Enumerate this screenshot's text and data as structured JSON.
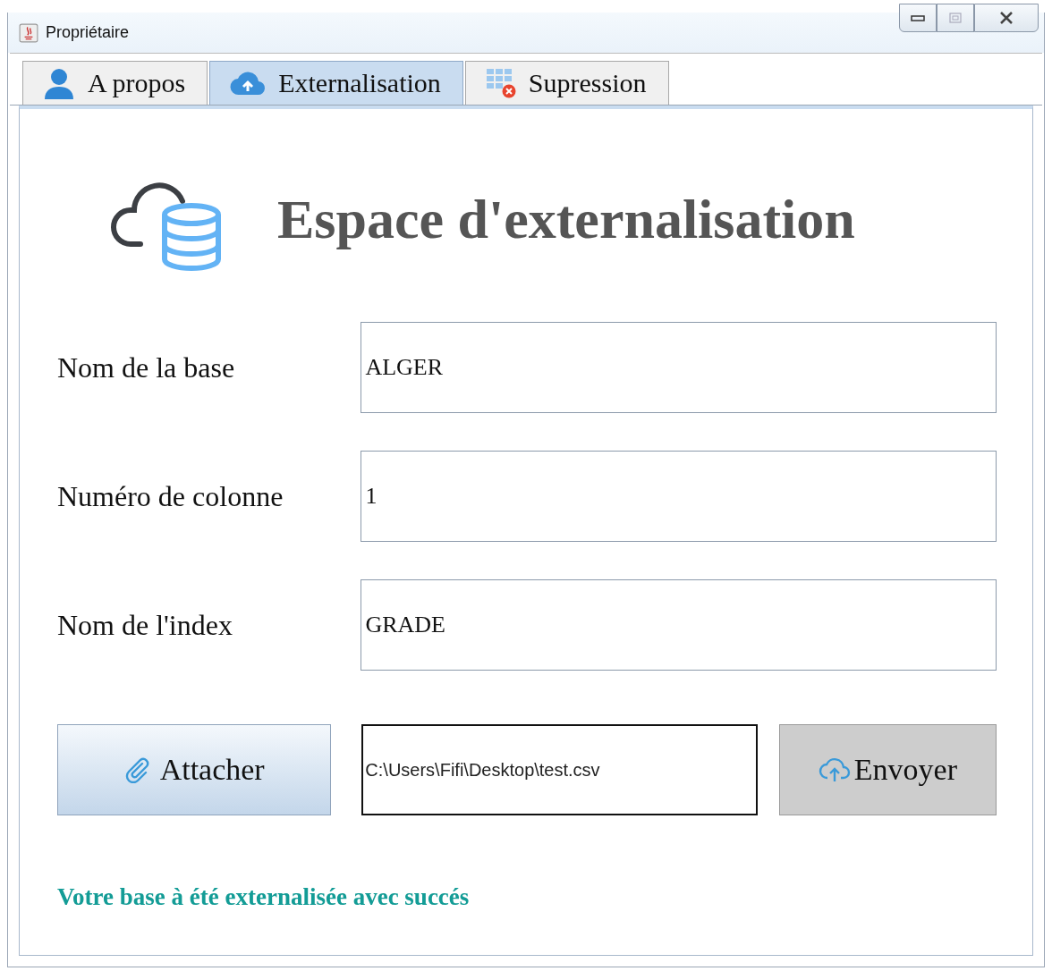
{
  "window": {
    "title": "Propriétaire"
  },
  "tabs": [
    {
      "label": "A propos",
      "kind": "person",
      "selected": false
    },
    {
      "label": "Externalisation",
      "kind": "cloud",
      "selected": true
    },
    {
      "label": "Supression",
      "kind": "table",
      "selected": false
    }
  ],
  "heading": "Espace d'externalisation",
  "fields": [
    {
      "label": "Nom de la base",
      "value": "ALGER"
    },
    {
      "label": "Numéro de colonne",
      "value": "1"
    },
    {
      "label": "Nom de l'index",
      "value": "GRADE"
    }
  ],
  "attach_button": "Attacher",
  "file_path": "C:\\Users\\Fifi\\Desktop\\test.csv",
  "send_button": "Envoyer",
  "status_message": "Votre base à été externalisée avec succés"
}
